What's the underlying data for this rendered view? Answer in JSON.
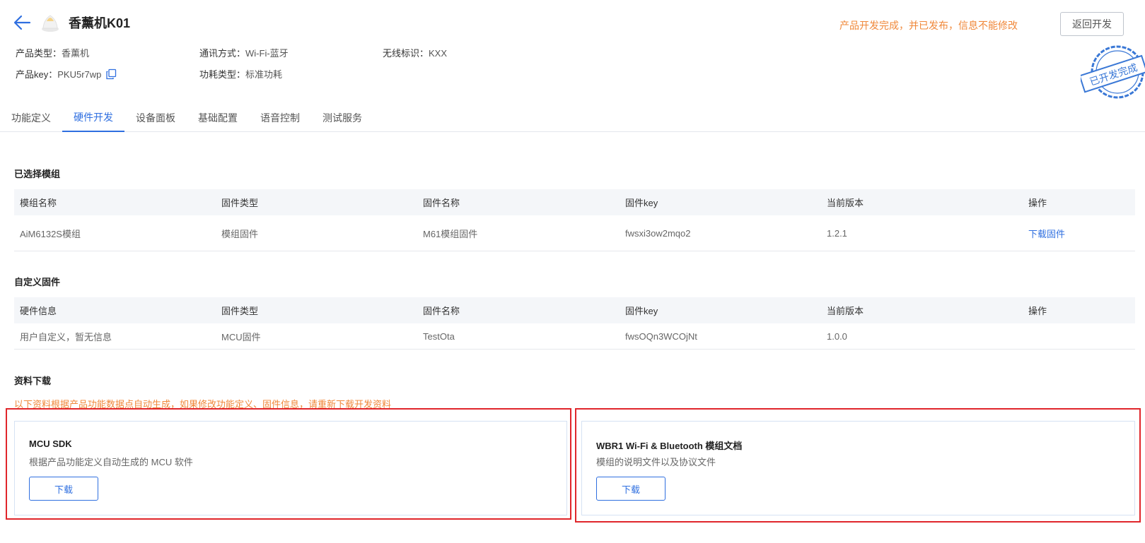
{
  "header": {
    "title": "香薰机K01",
    "notice": "产品开发完成，并已发布，信息不能修改",
    "return_label": "返回开发"
  },
  "meta": {
    "product_type_label": "产品类型：",
    "product_type_value": "香薰机",
    "comm_label": "通讯方式：",
    "comm_value": "Wi-Fi-蓝牙",
    "wireless_label": "无线标识：",
    "wireless_value": "KXX",
    "key_label": "产品key：",
    "key_value": "PKU5r7wp",
    "power_label": "功耗类型：",
    "power_value": "标准功耗"
  },
  "stamp": {
    "text": "已开发完成",
    "color": "#3a78d6"
  },
  "tabs": [
    {
      "label": "功能定义"
    },
    {
      "label": "硬件开发"
    },
    {
      "label": "设备面板"
    },
    {
      "label": "基础配置"
    },
    {
      "label": "语音控制"
    },
    {
      "label": "测试服务"
    }
  ],
  "active_tab": "硬件开发",
  "selected_module": {
    "title": "已选择模组",
    "headers": [
      "模组名称",
      "固件类型",
      "固件名称",
      "固件key",
      "当前版本",
      "操作"
    ],
    "rows": [
      [
        "AiM6132S模组",
        "模组固件",
        "M61模组固件",
        "fwsxi3ow2mqo2",
        "1.2.1",
        "下载固件"
      ]
    ]
  },
  "custom_firmware": {
    "title": "自定义固件",
    "headers": [
      "硬件信息",
      "固件类型",
      "固件名称",
      "固件key",
      "当前版本",
      "操作"
    ],
    "rows": [
      [
        "用户自定义，暂无信息",
        "MCU固件",
        "TestOta",
        "fwsOQn3WCOjNt",
        "1.0.0",
        ""
      ]
    ]
  },
  "downloads": {
    "title": "资料下载",
    "warning": "以下资料根据产品功能数据点自动生成，如果修改功能定义、固件信息，请重新下载开发资料",
    "cards": [
      {
        "title": "MCU SDK",
        "desc": "根据产品功能定义自动生成的 MCU 软件",
        "button": "下载"
      },
      {
        "title": "WBR1 Wi-Fi & Bluetooth 模组文档",
        "desc": "模组的说明文件以及协议文件",
        "button": "下载"
      }
    ]
  },
  "colors": {
    "accent": "#2f6fe0",
    "warning": "#f0883a",
    "highlight": "#e0262b"
  }
}
